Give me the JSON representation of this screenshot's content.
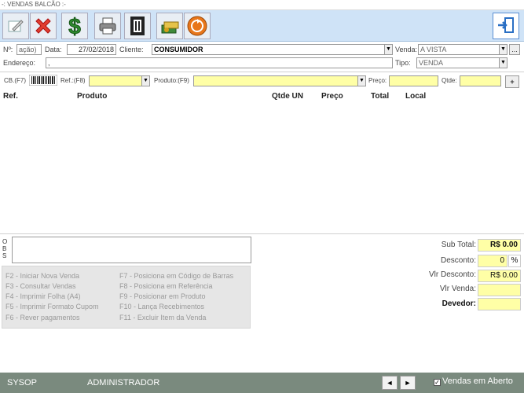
{
  "window": {
    "title": "-: VENDAS BALCÃO :-"
  },
  "toolbar": {
    "buttons": [
      {
        "name": "new-sale",
        "icon": "edit-icon"
      },
      {
        "name": "cancel",
        "icon": "close-icon",
        "color": "#e23d2f"
      },
      {
        "name": "payment",
        "icon": "dollar-icon",
        "color": "#2e8b2e"
      },
      {
        "name": "print",
        "icon": "printer-icon"
      },
      {
        "name": "receipt",
        "icon": "receipt-icon"
      },
      {
        "name": "finance",
        "icon": "money-icon"
      },
      {
        "name": "history",
        "icon": "refresh-icon",
        "color": "#e8761a"
      }
    ],
    "exit_icon": "exit-icon"
  },
  "form": {
    "num_label": "Nº:",
    "num_value": "ação)",
    "date_label": "Data:",
    "date_value": "27/02/2018",
    "client_label": "Cliente:",
    "client_value": "CONSUMIDOR",
    "venda_label": "Venda:",
    "venda_value": "A VISTA",
    "venda_more": "...",
    "address_label": "Endereço:",
    "address_value": ",",
    "tipo_label": "Tipo:",
    "tipo_value": "VENDA"
  },
  "search": {
    "cb_label": "CB.(F7)",
    "ref_label": "Ref.:(F8)",
    "ref_value": "",
    "produto_label": "Produto:(F9)",
    "produto_value": "",
    "preco_label": "Preço:",
    "preco_value": "",
    "qtde_label": "Qtde:",
    "qtde_value": "",
    "add_label": "+"
  },
  "table": {
    "headers": [
      "Ref.",
      "Produto",
      "Qtde UN",
      "Preço",
      "Total",
      "Local"
    ],
    "rows": []
  },
  "obs": {
    "letters": [
      "O",
      "B",
      "S"
    ],
    "value": ""
  },
  "shortcuts": {
    "left": [
      "F2 - Iniciar Nova Venda",
      "F3 - Consultar Vendas",
      "F4 - Imprimir Folha (A4)",
      "F5 - Imprimir Formato Cupom",
      "F6 - Rever pagamentos"
    ],
    "right": [
      "F7 - Posiciona em Código de Barras",
      "F8 - Posiciona em Referência",
      "F9 - Posicionar em Produto",
      "F10 - Lança Recebimentos",
      "F11 - Excluir Item da Venda"
    ]
  },
  "totals": {
    "subtotal_label": "Sub Total:",
    "subtotal_value": "R$ 0.00",
    "desconto_label": "Desconto:",
    "desconto_value": "0",
    "desconto_unit": "%",
    "vlr_desconto_label": "Vlr Desconto:",
    "vlr_desconto_value": "R$ 0.00",
    "vlr_venda_label": "Vlr Venda:",
    "vlr_venda_value": "",
    "devedor_label": "Devedor:",
    "devedor_value": ""
  },
  "status": {
    "user": "SYSOP",
    "role": "ADMINISTRADOR",
    "prev_label": "◄",
    "next_label": "►",
    "open_sales_label": "Vendas em Aberto",
    "open_sales_checked": true,
    "check_mark": "✓"
  }
}
